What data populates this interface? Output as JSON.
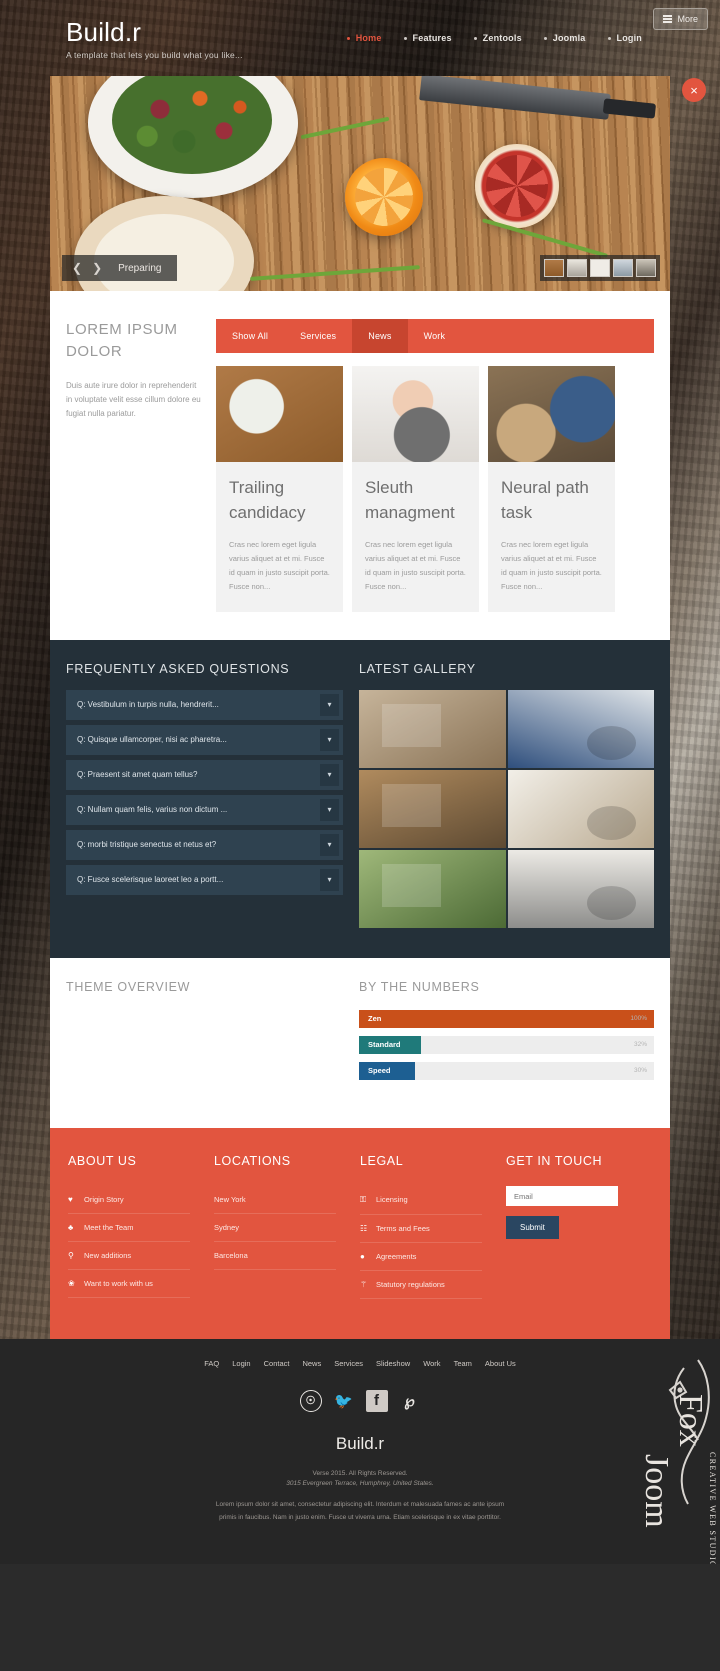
{
  "header": {
    "brand_title": "Build.r",
    "brand_tagline": "A template that lets you build what you like...",
    "more_label": "More",
    "nav": [
      {
        "label": "Home",
        "active": true
      },
      {
        "label": "Features",
        "active": false
      },
      {
        "label": "Zentools",
        "active": false
      },
      {
        "label": "Joomla",
        "active": false
      },
      {
        "label": "Login",
        "active": false
      }
    ]
  },
  "slider": {
    "caption": "Preparing",
    "prev_icon": "chevron-left-icon",
    "next_icon": "chevron-right-icon",
    "thumb_count": 5
  },
  "portfolio": {
    "heading": "LOREM IPSUM DOLOR",
    "description": "Duis aute irure dolor in reprehenderit in voluptate velit esse cillum dolore eu fugiat nulla pariatur.",
    "filters": [
      {
        "label": "Show All",
        "active": false
      },
      {
        "label": "Services",
        "active": false
      },
      {
        "label": "News",
        "active": true
      },
      {
        "label": "Work",
        "active": false
      }
    ],
    "cards": [
      {
        "title": "Trailing candidacy",
        "text": "Cras nec lorem eget ligula varius aliquet at et mi. Fusce id quam in justo suscipit porta. Fusce non..."
      },
      {
        "title": "Sleuth managment",
        "text": "Cras nec lorem eget ligula varius aliquet at et mi. Fusce id quam in justo suscipit porta. Fusce non..."
      },
      {
        "title": "Neural path task",
        "text": "Cras nec lorem eget ligula varius aliquet at et mi. Fusce id quam in justo suscipit porta. Fusce non..."
      }
    ]
  },
  "faq": {
    "heading": "FREQUENTLY ASKED QUESTIONS",
    "items": [
      "Q: Vestibulum in turpis nulla, hendrerit...",
      "Q: Quisque ullamcorper, nisi ac pharetra...",
      "Q: Praesent sit amet quam tellus?",
      "Q: Nullam quam felis, varius non dictum ...",
      "Q: morbi tristique senectus et netus et?",
      "Q: Fusce scelerisque laoreet leo a portt..."
    ]
  },
  "gallery": {
    "heading": "LATEST GALLERY"
  },
  "theme_overview": {
    "heading": "THEME OVERVIEW"
  },
  "numbers": {
    "heading": "BY THE NUMBERS",
    "bars": [
      {
        "label": "Zen",
        "percent": 100,
        "percent_label": "100%",
        "color": "#c9501a",
        "width": 100
      },
      {
        "label": "Standard",
        "percent": 32,
        "percent_label": "32%",
        "color": "#1f7a7a",
        "width": 21
      },
      {
        "label": "Speed",
        "percent": 30,
        "percent_label": "30%",
        "color": "#1d5f92",
        "width": 19
      }
    ]
  },
  "footer": {
    "about": {
      "heading": "ABOUT US",
      "links": [
        {
          "label": "Origin Story",
          "icon": "heart-icon",
          "glyph": "♥"
        },
        {
          "label": "Meet the Team",
          "icon": "users-icon",
          "glyph": "♣"
        },
        {
          "label": "New additions",
          "icon": "search-icon",
          "glyph": "⚲"
        },
        {
          "label": "Want to work with us",
          "icon": "briefcase-icon",
          "glyph": "❀"
        }
      ]
    },
    "locations": {
      "heading": "LOCATIONS",
      "links": [
        "New York",
        "Sydney",
        "Barcelona"
      ]
    },
    "legal": {
      "heading": "LEGAL",
      "links": [
        {
          "label": "Licensing",
          "icon": "lock-icon",
          "glyph": "⚿"
        },
        {
          "label": "Terms and Fees",
          "icon": "document-icon",
          "glyph": "☷"
        },
        {
          "label": "Agreements",
          "icon": "check-circle-icon",
          "glyph": "●"
        },
        {
          "label": "Statutory regulations",
          "icon": "gavel-icon",
          "glyph": "⚚"
        }
      ]
    },
    "contact": {
      "heading": "GET IN TOUCH",
      "email_placeholder": "Email",
      "email_value": "",
      "submit_label": "Submit"
    }
  },
  "bottom": {
    "links": [
      "FAQ",
      "Login",
      "Contact",
      "News",
      "Services",
      "Slideshow",
      "Work",
      "Team",
      "About Us"
    ],
    "socials": [
      {
        "name": "dribbble-icon",
        "glyph": "●"
      },
      {
        "name": "twitter-icon",
        "glyph": "ᵥ"
      },
      {
        "name": "facebook-icon",
        "glyph": "f"
      },
      {
        "name": "pinterest-icon",
        "glyph": "℘"
      }
    ],
    "brand": "Build.r",
    "copyright_line1": "Verse  2015. All Rights Reserved.",
    "copyright_line2": "3015 Evergreen Terrace, Humphrey, United States.",
    "copyright_line3": "Lorem ipsum dolor sit amet, consectetur adipiscing elit. Interdum et malesuada fames ac ante ipsum primis in faucibus. Nam in justo enim. Fusce ut viverra urna. Etiam scelerisque in ex vitae porttitor.",
    "watermark": "JoomFox Creative Web Studio"
  }
}
